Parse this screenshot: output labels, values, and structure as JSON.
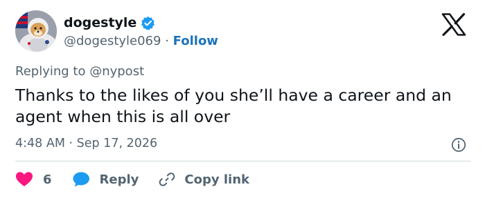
{
  "user": {
    "display_name": "dogestyle",
    "handle": "@dogestyle069",
    "separator": "·",
    "follow_label": "Follow"
  },
  "reply_context": {
    "label": "Replying to @nypost"
  },
  "tweet": {
    "text": "Thanks to the likes of you she’ll have a career and an agent when this is all over",
    "time": "4:48 AM",
    "separator": "·",
    "date": "Sep 17, 2026"
  },
  "actions": {
    "like_count": "6",
    "reply_label": "Reply",
    "copy_link_label": "Copy link"
  },
  "colors": {
    "like": "#f91880",
    "reply": "#1d9bf0",
    "verified": "#1d9bf0",
    "follow": "#1d73b9",
    "secondary_text": "#536471"
  },
  "icons": {
    "verified": "verified-badge-icon",
    "brand": "x-logo-icon",
    "info": "info-icon",
    "like": "heart-icon",
    "reply": "speech-bubble-icon",
    "copy_link": "link-icon"
  }
}
